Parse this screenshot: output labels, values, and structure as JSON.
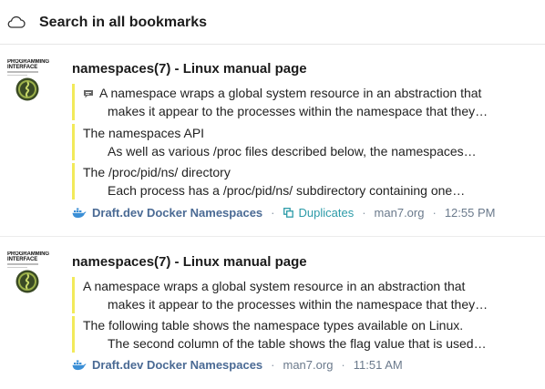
{
  "header": {
    "title": "Search in all bookmarks",
    "icon": "cloud-icon"
  },
  "results": [
    {
      "thumb": {
        "line1": "PROGRAMMING",
        "line2": "INTERFACE"
      },
      "title": "namespaces(7) - Linux manual page",
      "highlights": [
        {
          "has_note": true,
          "line1": "A namespace wraps a global system resource in an abstraction that",
          "line2": "makes it appear to the processes within the namespace that they…"
        },
        {
          "has_note": false,
          "line1": "The namespaces API",
          "line2": "As well as various /proc files described below, the namespaces…"
        },
        {
          "has_note": false,
          "line1": "The /proc/pid/ns/ directory",
          "line2": "Each process has a /proc/pid/ns/ subdirectory containing one…"
        }
      ],
      "meta": {
        "collection": "Draft.dev Docker Namespaces",
        "duplicates": "Duplicates",
        "domain": "man7.org",
        "time": "12:55 PM"
      }
    },
    {
      "thumb": {
        "line1": "PROGRAMMING",
        "line2": "INTERFACE"
      },
      "title": "namespaces(7) - Linux manual page",
      "highlights": [
        {
          "has_note": false,
          "line1": "A namespace wraps a global system resource in an abstraction that",
          "line2": "makes it appear to the processes within the namespace that they…"
        },
        {
          "has_note": false,
          "line1": "The following table shows the namespace types available on Linux.",
          "line2": "The second column of the table shows the flag value that is used…"
        }
      ],
      "meta": {
        "collection": "Draft.dev Docker Namespaces",
        "domain": "man7.org",
        "time": "11:51 AM"
      }
    }
  ],
  "colors": {
    "highlight_bar": "#f2ea5a",
    "meta": "#6b7a8c",
    "duplicates": "#2c9ba8",
    "collection": "#4a6a94"
  }
}
